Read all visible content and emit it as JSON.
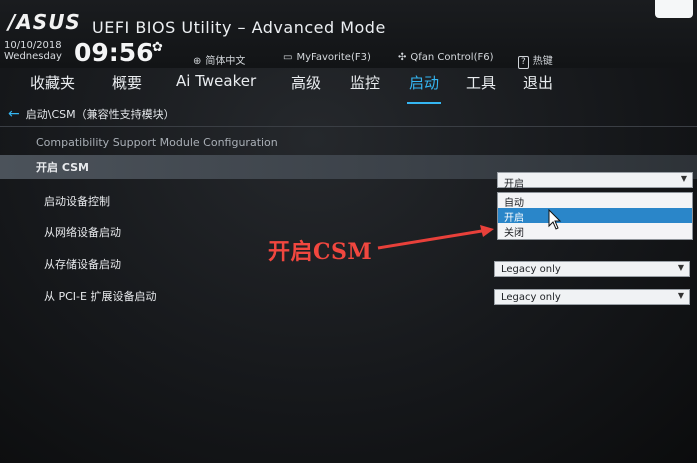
{
  "header": {
    "brand": "/ASUS",
    "title": "UEFI BIOS Utility – Advanced Mode",
    "date": "10/10/2018",
    "weekday": "Wednesday",
    "time": "09:56",
    "language": "简体中文",
    "myfavorite": "MyFavorite(F3)",
    "qfan": "Qfan Control(F6)",
    "hotkeys": "热键",
    "hotkeys_icon": "?"
  },
  "nav": {
    "tabs": [
      {
        "label": "收藏夹"
      },
      {
        "label": "概要"
      },
      {
        "label": "Ai Tweaker"
      },
      {
        "label": "高级"
      },
      {
        "label": "监控"
      },
      {
        "label": "启动"
      },
      {
        "label": "工具"
      },
      {
        "label": "退出"
      }
    ],
    "active_index": 5
  },
  "page": {
    "breadcrumb": "启动\\CSM（兼容性支持模块）",
    "subtitle": "Compatibility Support Module Configuration"
  },
  "settings": [
    {
      "label": "开启 CSM",
      "value": "开启"
    },
    {
      "label": "启动设备控制",
      "value": ""
    },
    {
      "label": "从网络设备启动",
      "value": ""
    },
    {
      "label": "从存储设备启动",
      "value": "Legacy only"
    },
    {
      "label": "从 PCI-E 扩展设备启动",
      "value": "Legacy only"
    }
  ],
  "dropdown": {
    "options": [
      "自动",
      "开启",
      "关闭"
    ],
    "highlighted_index": 1
  },
  "annotation": {
    "text": "开启CSM",
    "color": "#f1473f"
  },
  "colors": {
    "accent": "#35b6f2",
    "selection": "#2a86c9"
  }
}
